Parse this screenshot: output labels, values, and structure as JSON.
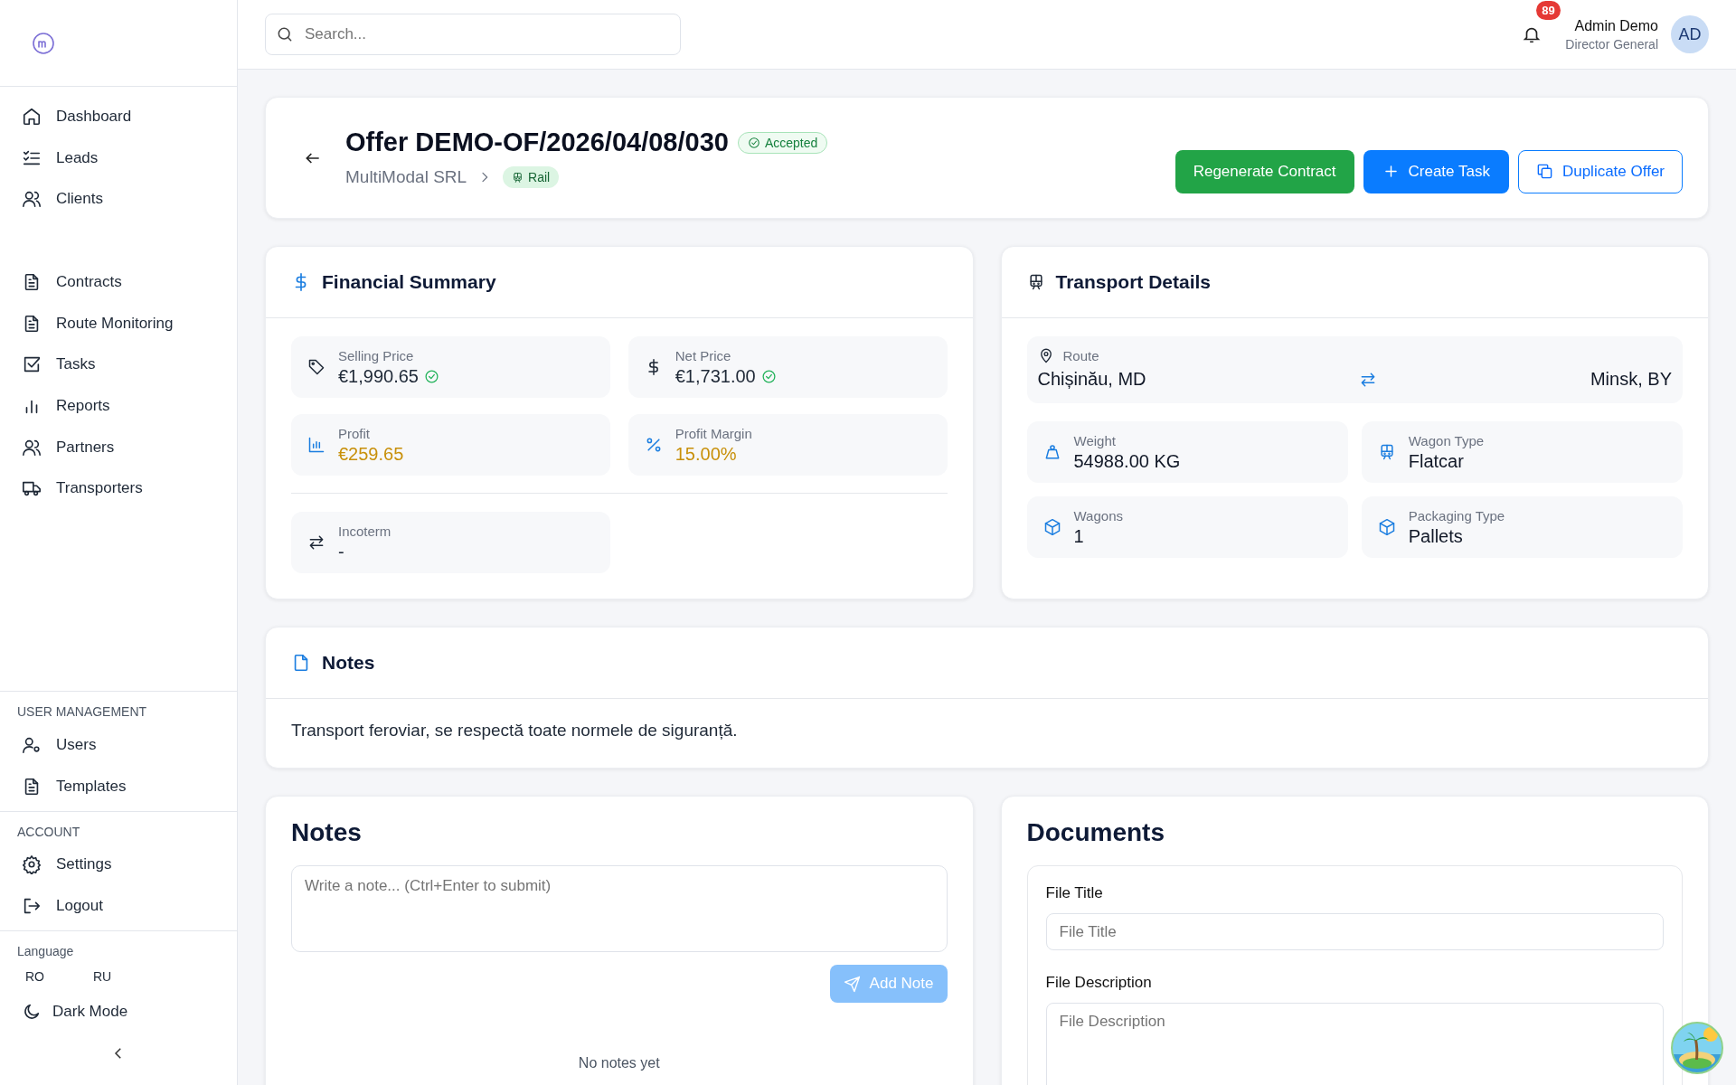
{
  "sidebar": {
    "nav_groups": [
      {
        "items": [
          {
            "label": "Dashboard",
            "selected": false
          },
          {
            "label": "Leads",
            "selected": false
          },
          {
            "label": "Clients",
            "selected": false
          }
        ]
      },
      {
        "items": [
          {
            "label": "Contracts",
            "selected": false
          },
          {
            "label": "Route Monitoring",
            "selected": false
          },
          {
            "label": "Tasks",
            "selected": false
          },
          {
            "label": "Reports",
            "selected": false
          },
          {
            "label": "Partners",
            "selected": false
          },
          {
            "label": "Transporters",
            "selected": false
          }
        ]
      }
    ],
    "sections": [
      {
        "title": "USER MANAGEMENT",
        "items": [
          {
            "label": "Users",
            "selected": false
          },
          {
            "label": "Templates",
            "selected": false
          }
        ]
      },
      {
        "title": "ACCOUNT",
        "items": [
          {
            "label": "Settings",
            "selected": false
          },
          {
            "label": "Logout",
            "selected": false
          }
        ]
      }
    ],
    "language": {
      "title": "Language",
      "options": [
        {
          "label": "RO",
          "selected": false
        },
        {
          "label": "RU",
          "selected": false
        }
      ]
    },
    "dark_mode": {
      "label": "Dark Mode",
      "on": false
    }
  },
  "topbar": {
    "search": {
      "placeholder": "Search..."
    },
    "notifications": {
      "count": "89"
    },
    "user": {
      "name": "Admin Demo",
      "role": "Director General",
      "initials": "AD"
    }
  },
  "offer": {
    "title": "Offer DEMO-OF/2026/04/08/030",
    "status": "Accepted",
    "client": "MultiModal SRL",
    "mode": "Rail",
    "buttons": [
      {
        "label": "Regenerate Contract",
        "kind": "success"
      },
      {
        "label": "Create Task",
        "kind": "primary"
      },
      {
        "label": "Duplicate Offer",
        "kind": "outline"
      }
    ]
  },
  "financial_summary": {
    "title": "Financial Summary",
    "items": [
      {
        "label": "Selling Price",
        "value": "€1,990.65",
        "verified": true,
        "highlighted": false
      },
      {
        "label": "Net Price",
        "value": "€1,731.00",
        "verified": true,
        "highlighted": false
      },
      {
        "label": "Profit",
        "value": "€259.65",
        "verified": false,
        "highlighted": true
      },
      {
        "label": "Profit Margin",
        "value": "15.00%",
        "verified": false,
        "highlighted": true
      }
    ],
    "incoterm": {
      "label": "Incoterm",
      "value": "-"
    }
  },
  "transport_details": {
    "title": "Transport Details",
    "route": {
      "label": "Route",
      "from": "Chișinău, MD",
      "to": "Minsk, BY"
    },
    "items": [
      {
        "label": "Weight",
        "value": "54988.00 KG"
      },
      {
        "label": "Wagon Type",
        "value": "Flatcar"
      },
      {
        "label": "Wagons",
        "value": "1"
      },
      {
        "label": "Packaging Type",
        "value": "Pallets"
      }
    ]
  },
  "offer_notes": {
    "title": "Notes",
    "text": "Transport feroviar, se respectă toate normele de siguranță."
  },
  "notes_panel": {
    "title": "Notes",
    "input": {
      "placeholder": "Write a note... (Ctrl+Enter to submit)"
    },
    "add_button": {
      "label": "Add Note",
      "disabled": true
    },
    "empty_text": "No notes yet"
  },
  "documents": {
    "title": "Documents",
    "fields": [
      {
        "label": "File Title",
        "placeholder": "File Title",
        "kind": "input"
      },
      {
        "label": "File Description",
        "placeholder": "File Description",
        "kind": "textarea"
      }
    ]
  }
}
